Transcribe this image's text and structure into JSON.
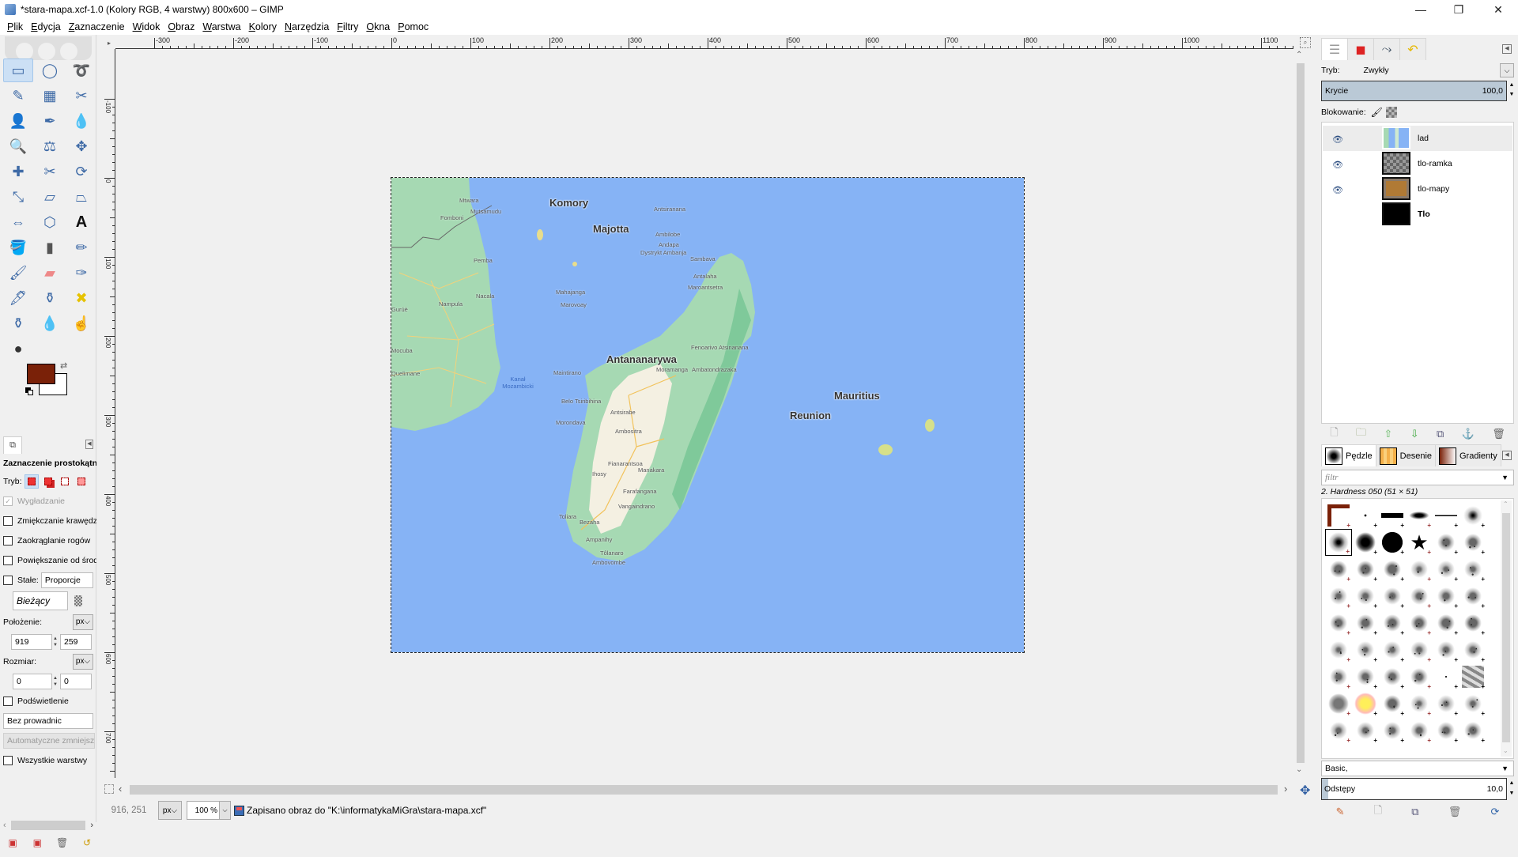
{
  "window": {
    "title": "*stara-mapa.xcf-1.0 (Kolory RGB, 4 warstwy) 800x600 – GIMP",
    "controls": {
      "minimize": "—",
      "maximize": "❐",
      "close": "✕"
    }
  },
  "menu": [
    "Plik",
    "Edycja",
    "Zaznaczenie",
    "Widok",
    "Obraz",
    "Warstwa",
    "Kolory",
    "Narzędzia",
    "Filtry",
    "Okna",
    "Pomoc"
  ],
  "toolbox": {
    "tools": [
      {
        "name": "rect-select",
        "glyph": "▭",
        "active": true
      },
      {
        "name": "ellipse-select",
        "glyph": "◯"
      },
      {
        "name": "free-select",
        "glyph": "➰"
      },
      {
        "name": "fuzzy-select",
        "glyph": "✎"
      },
      {
        "name": "select-by-color",
        "glyph": "▦"
      },
      {
        "name": "scissors-select",
        "glyph": "✂"
      },
      {
        "name": "foreground-select",
        "glyph": "👤"
      },
      {
        "name": "paths",
        "glyph": "✒"
      },
      {
        "name": "color-picker",
        "glyph": "💧"
      },
      {
        "name": "zoom",
        "glyph": "🔍"
      },
      {
        "name": "measure",
        "glyph": "⚖"
      },
      {
        "name": "move",
        "glyph": "✥"
      },
      {
        "name": "alignment",
        "glyph": "✚"
      },
      {
        "name": "crop",
        "glyph": "✂"
      },
      {
        "name": "rotate",
        "glyph": "⟳"
      },
      {
        "name": "scale",
        "glyph": "⤡"
      },
      {
        "name": "shear",
        "glyph": "▱"
      },
      {
        "name": "perspective",
        "glyph": "⏢"
      },
      {
        "name": "flip",
        "glyph": "⇔"
      },
      {
        "name": "cage-transform",
        "glyph": "⬡"
      },
      {
        "name": "text",
        "glyph": "A"
      },
      {
        "name": "bucket-fill",
        "glyph": "🪣"
      },
      {
        "name": "blend",
        "glyph": "▮"
      },
      {
        "name": "pencil",
        "glyph": "✏"
      },
      {
        "name": "paintbrush",
        "glyph": "🖌"
      },
      {
        "name": "eraser",
        "glyph": "▰"
      },
      {
        "name": "airbrush",
        "glyph": "✑"
      },
      {
        "name": "ink",
        "glyph": "🖋"
      },
      {
        "name": "clone",
        "glyph": "⚱"
      },
      {
        "name": "heal",
        "glyph": "✖"
      },
      {
        "name": "perspective-clone",
        "glyph": "⚱"
      },
      {
        "name": "blur-sharpen",
        "glyph": "💧"
      },
      {
        "name": "smudge",
        "glyph": "☝"
      },
      {
        "name": "dodge-burn",
        "glyph": "●"
      }
    ],
    "fg_color": "#7a2108",
    "bg_color": "#ffffff"
  },
  "tool_options": {
    "title": "Zaznaczenie prostokątne",
    "mode_label": "Tryb:",
    "antialias_label": "Wygładzanie",
    "antialias_checked": true,
    "feather_label": "Zmiękczanie krawędzi",
    "rounded_label": "Zaokrąglanie rogów",
    "expand_label": "Powiększanie od środka",
    "fixed_label": "Stałe:",
    "fixed_value": "Proporcje",
    "current_value": "Bieżący",
    "position_label": "Położenie:",
    "position_unit": "px",
    "position_x": "919",
    "position_y": "259",
    "size_label": "Rozmiar:",
    "size_unit": "px",
    "size_w": "0",
    "size_h": "0",
    "highlight_label": "Podświetlenie",
    "guides_value": "Bez prowadnic",
    "autoshrink_label": "Automatyczne zmniejszanie",
    "all_layers_label": "Wszystkie warstwy"
  },
  "rulers": {
    "top": [
      "-300",
      "-200",
      "-100",
      "0",
      "100",
      "200",
      "300",
      "400",
      "500",
      "600",
      "700",
      "800",
      "900",
      "1000",
      "1100"
    ],
    "left": [
      "-100",
      "0",
      "100",
      "200",
      "300",
      "400",
      "500",
      "600",
      "700"
    ]
  },
  "map": {
    "big_labels": [
      "Komory",
      "Majotta",
      "Antananarywa",
      "Mauritius",
      "Reunion"
    ],
    "small_labels": [
      "Mtwara",
      "Pemba",
      "Nacala",
      "Nampula",
      "Gurúè",
      "Mocuba",
      "Quelimane",
      "Mutsamudu",
      "Fomboni",
      "Antsiranana",
      "Ambilobe",
      "Andapa",
      "Dystrykt Ambanja",
      "Sambava",
      "Antalaha",
      "Maroantsetra",
      "Mahajanga",
      "Marovoay",
      "Maintirano",
      "Fenoarivo Atsinanana",
      "Ambatondrazaka",
      "Moramanga",
      "Belo Tsiribihina",
      "Morondava",
      "Antsirabe",
      "Ambositra",
      "Fianarantsoa",
      "Manakara",
      "Ihosy",
      "Farafangana",
      "Vangaindrano",
      "Toliara",
      "Bezaha",
      "Ampanihy",
      "Tôlanaro",
      "Ambovombe"
    ],
    "sea_label": "Kanał Mozambicki"
  },
  "status": {
    "coords": "916, 251",
    "unit": "px",
    "zoom": "100 %",
    "message": "Zapisano obraz do \"K:\\informatykaMiGra\\stara-mapa.xcf\""
  },
  "layers_panel": {
    "mode_label": "Tryb:",
    "mode_value": "Zwykły",
    "opacity_label": "Krycie",
    "opacity_value": "100,0",
    "lock_label": "Blokowanie:",
    "layers": [
      {
        "name": "lad",
        "visible": true,
        "selected": true,
        "bold": false
      },
      {
        "name": "tlo-ramka",
        "visible": true,
        "selected": false,
        "bold": false
      },
      {
        "name": "tlo-mapy",
        "visible": true,
        "selected": false,
        "bold": false
      },
      {
        "name": "Tlo",
        "visible": false,
        "selected": false,
        "bold": true
      }
    ]
  },
  "brushes_panel": {
    "tabs": [
      "Pędzle",
      "Desenie",
      "Gradienty"
    ],
    "filter_placeholder": "filtr",
    "selected_brush": "2. Hardness 050 (51 × 51)",
    "tag_value": "Basic,",
    "spacing_label": "Odstępy",
    "spacing_value": "10,0"
  }
}
